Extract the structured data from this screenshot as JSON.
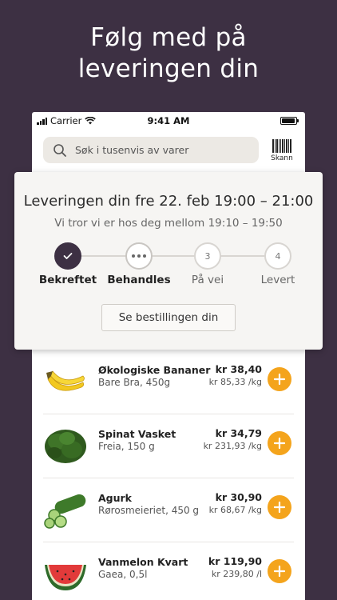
{
  "promo": {
    "line1": "Følg med på",
    "line2": "leveringen din"
  },
  "status_bar": {
    "carrier": "Carrier",
    "time": "9:41 AM"
  },
  "search": {
    "placeholder": "Søk i tusenvis av varer",
    "scan_label": "Skann"
  },
  "delivery": {
    "title": "Leveringen din fre 22. feb 19:00 – 21:00",
    "subtitle": "Vi tror vi er hos deg mellom 19:10 – 19:50",
    "steps": [
      {
        "label": "Bekreftet",
        "state": "done"
      },
      {
        "label": "Behandles",
        "state": "active"
      },
      {
        "label": "På vei",
        "number": "3",
        "state": "pending"
      },
      {
        "label": "Levert",
        "number": "4",
        "state": "pending"
      }
    ],
    "order_button": "Se bestillingen din"
  },
  "products": [
    {
      "name": "Økologiske Bananer",
      "brand": "Bare Bra, 450g",
      "price": "kr 38,40",
      "unit_price": "kr 85,33 /kg",
      "icon": "banana-image"
    },
    {
      "name": "Spinat Vasket",
      "brand": "Freia, 150 g",
      "price": "kr 34,79",
      "unit_price": "kr 231,93 /kg",
      "icon": "spinach-image"
    },
    {
      "name": "Agurk",
      "brand": "Rørosmeieriet, 450 g",
      "price": "kr 30,90",
      "unit_price": "kr 68,67 /kg",
      "icon": "cucumber-image"
    },
    {
      "name": "Vanmelon Kvart",
      "brand": "Gaea, 0,5l",
      "price": "kr 119,90",
      "unit_price": "kr 239,80 /l",
      "icon": "watermelon-image"
    }
  ],
  "colors": {
    "background": "#3d3043",
    "accent": "#f4a41c"
  }
}
